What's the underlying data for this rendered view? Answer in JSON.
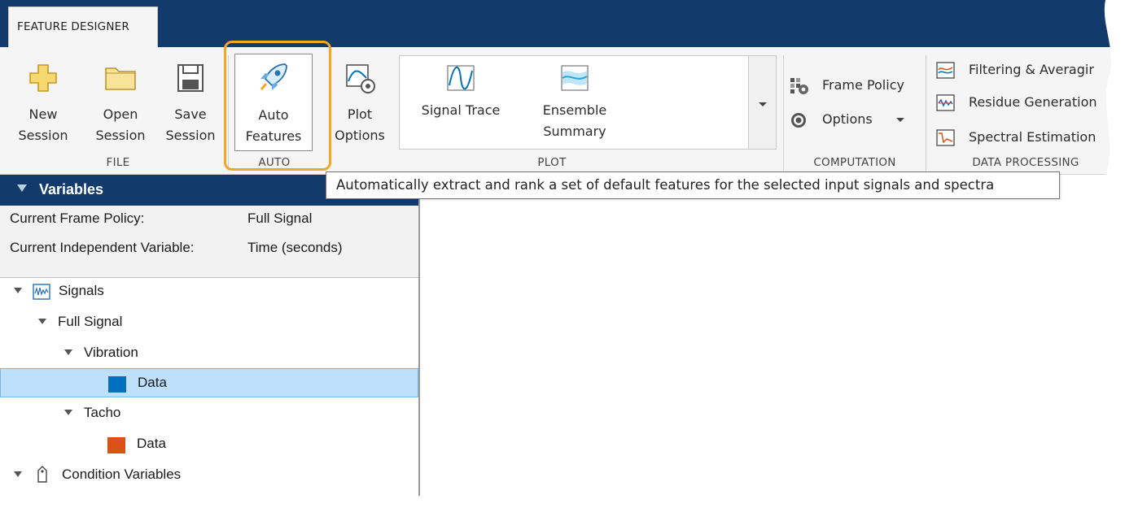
{
  "toolstrip": {
    "tab_label": "FEATURE DESIGNER"
  },
  "file_group": {
    "label": "FILE",
    "new_session": [
      "New",
      "Session"
    ],
    "open_session": [
      "Open",
      "Session"
    ],
    "save_session": [
      "Save",
      "Session"
    ]
  },
  "auto_group": {
    "label": "AUTO",
    "auto_features": [
      "Auto",
      "Features"
    ]
  },
  "plot_group": {
    "label": "PLOT",
    "plot_options": [
      "Plot",
      "Options"
    ],
    "signal_trace": "Signal Trace",
    "ensemble_summary": [
      "Ensemble",
      "Summary"
    ]
  },
  "computation_group": {
    "label": "COMPUTATION",
    "frame_policy": "Frame Policy",
    "options": "Options"
  },
  "data_processing_group": {
    "label": "DATA PROCESSING",
    "filtering": "Filtering & Averagir",
    "residue": "Residue Generation",
    "spectral": "Spectral Estimation"
  },
  "tooltip": "Automatically extract and rank a set of default features for the selected input signals and spectra",
  "variables_panel": {
    "title": "Variables",
    "frame_policy_label": "Current Frame Policy:",
    "frame_policy_value": "Full Signal",
    "indep_var_label": "Current Independent Variable:",
    "indep_var_value": "Time (seconds)",
    "tree": [
      {
        "label": "Signals"
      },
      {
        "label": "Full Signal"
      },
      {
        "label": "Vibration"
      },
      {
        "label": "Data",
        "selected": true
      },
      {
        "label": "Tacho"
      },
      {
        "label": "Data"
      },
      {
        "label": "Condition Variables"
      }
    ]
  },
  "colors": {
    "header_blue": "#123b6b",
    "highlight_orange": "#f5a623",
    "vibration_swatch": "#0072bd",
    "tacho_swatch": "#d95319",
    "selection": "#bfe0fb"
  }
}
